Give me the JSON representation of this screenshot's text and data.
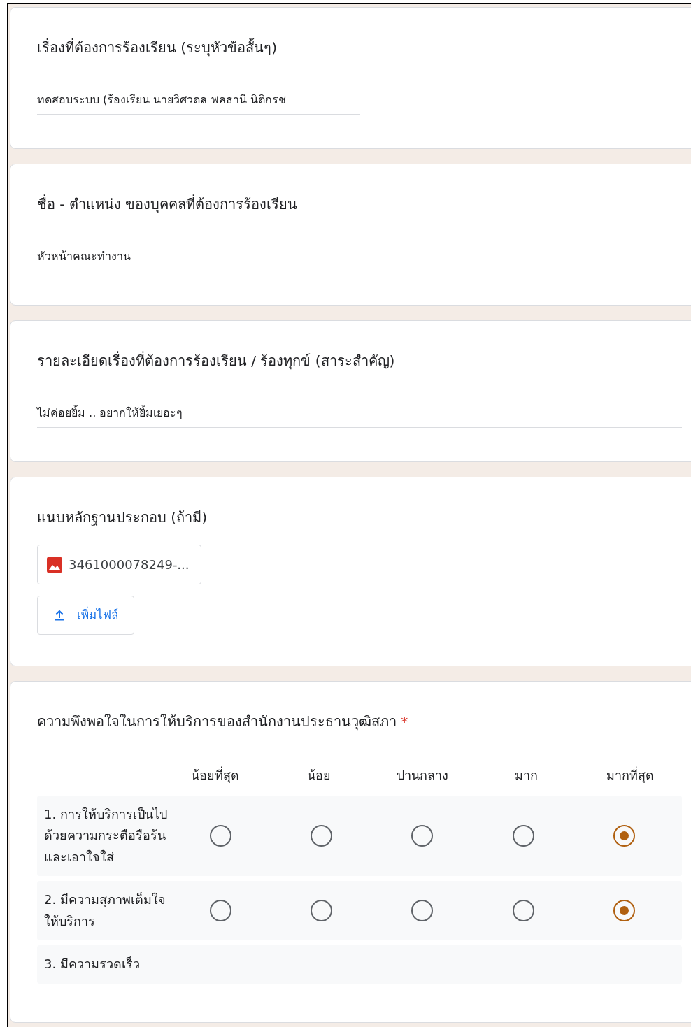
{
  "questions": [
    {
      "kind": "short_text",
      "title": "เรื่องที่ต้องการร้องเรียน (ระบุหัวข้อสั้นๆ)",
      "value": "ทดสอบระบบ (ร้องเรียน นายวิศวดล พลธานี นิติกรช"
    },
    {
      "kind": "short_text",
      "title": "ชื่อ - ตำแหน่ง ของบุคคลที่ต้องการร้องเรียน",
      "value": "หัวหน้าคณะทำงาน"
    },
    {
      "kind": "paragraph",
      "title": "รายละเอียดเรื่องที่ต้องการร้องเรียน / ร้องทุกข์ (สาระสำคัญ)",
      "value": "ไม่ค่อยยิ้ม .. อยากให้ยิ้มเยอะๆ"
    },
    {
      "kind": "file_upload",
      "title": "แนบหลักฐานประกอบ (ถ้ามี)",
      "files": [
        {
          "name": "3461000078249-..."
        }
      ],
      "add_button": "เพิ่มไฟล์"
    },
    {
      "kind": "grid",
      "title": "ความพึงพอใจในการให้บริการของสำนักงานประธานวุฒิสภา",
      "required_mark": "*",
      "columns": [
        "น้อยที่สุด",
        "น้อย",
        "ปานกลาง",
        "มาก",
        "มากที่สุด"
      ],
      "rows": [
        {
          "label": "1. การให้บริการเป็นไปด้วยความกระตือรือร้น และเอาใจใส่",
          "choices": [
            {
              "selected": false
            },
            {
              "selected": false
            },
            {
              "selected": false
            },
            {
              "selected": false
            },
            {
              "selected": true
            }
          ]
        },
        {
          "label": "2. มีความสุภาพเต็มใจให้บริการ",
          "choices": [
            {
              "selected": false
            },
            {
              "selected": false
            },
            {
              "selected": false
            },
            {
              "selected": false
            },
            {
              "selected": true
            }
          ]
        },
        {
          "label": "3. มีความรวดเร็ว"
        }
      ]
    }
  ]
}
